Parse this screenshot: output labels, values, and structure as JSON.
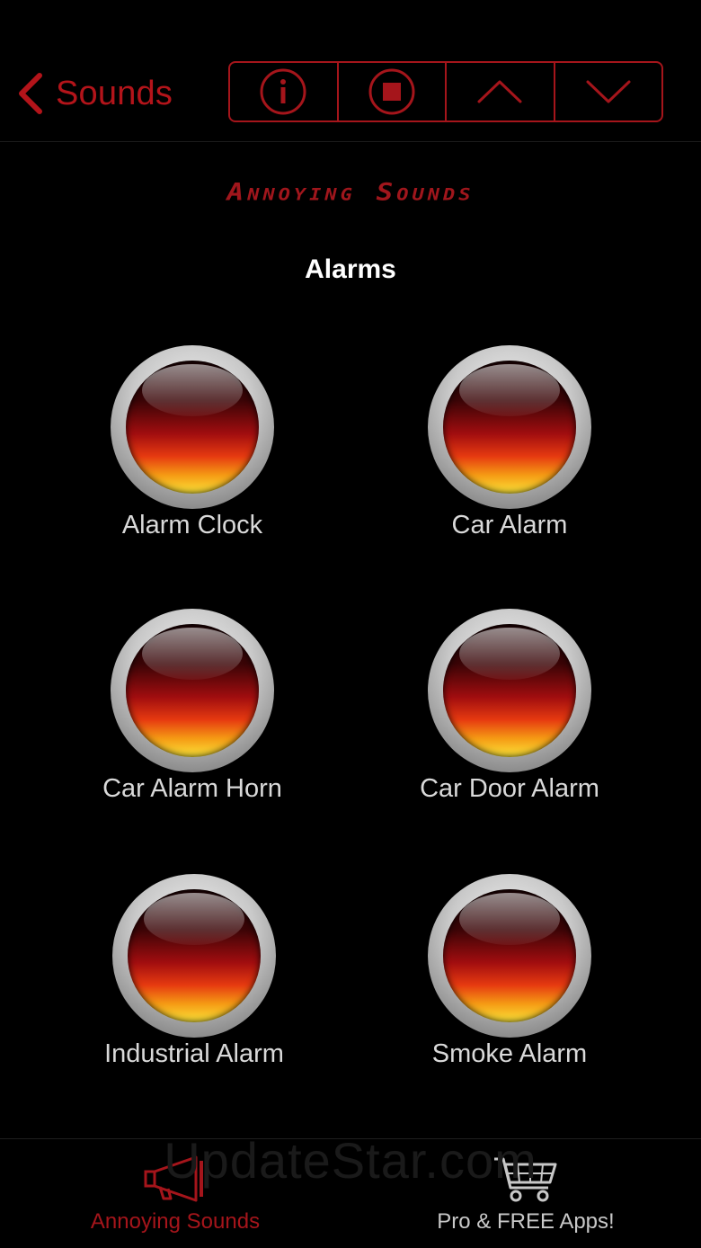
{
  "nav": {
    "back_label": "Sounds",
    "controls": [
      {
        "name": "info",
        "icon": "info-icon"
      },
      {
        "name": "stop",
        "icon": "stop-icon"
      },
      {
        "name": "previous",
        "icon": "chevron-up-icon"
      },
      {
        "name": "next",
        "icon": "chevron-down-icon"
      }
    ]
  },
  "header": {
    "app_title": "Annoying Sounds",
    "category": "Alarms"
  },
  "sounds": [
    {
      "label": "Alarm Clock"
    },
    {
      "label": "Car Alarm"
    },
    {
      "label": "Car Alarm Horn"
    },
    {
      "label": "Car Door Alarm"
    },
    {
      "label": "Industrial Alarm"
    },
    {
      "label": "Smoke Alarm"
    }
  ],
  "watermark": "UpdateStar.com",
  "tabs": [
    {
      "label": "Annoying Sounds",
      "icon": "megaphone-icon",
      "selected": true
    },
    {
      "label": "Pro & FREE Apps!",
      "icon": "shopping-cart-icon",
      "selected": false
    }
  ],
  "colors": {
    "accent": "#a5151b",
    "background": "#000000",
    "label": "#d9d9d9"
  }
}
